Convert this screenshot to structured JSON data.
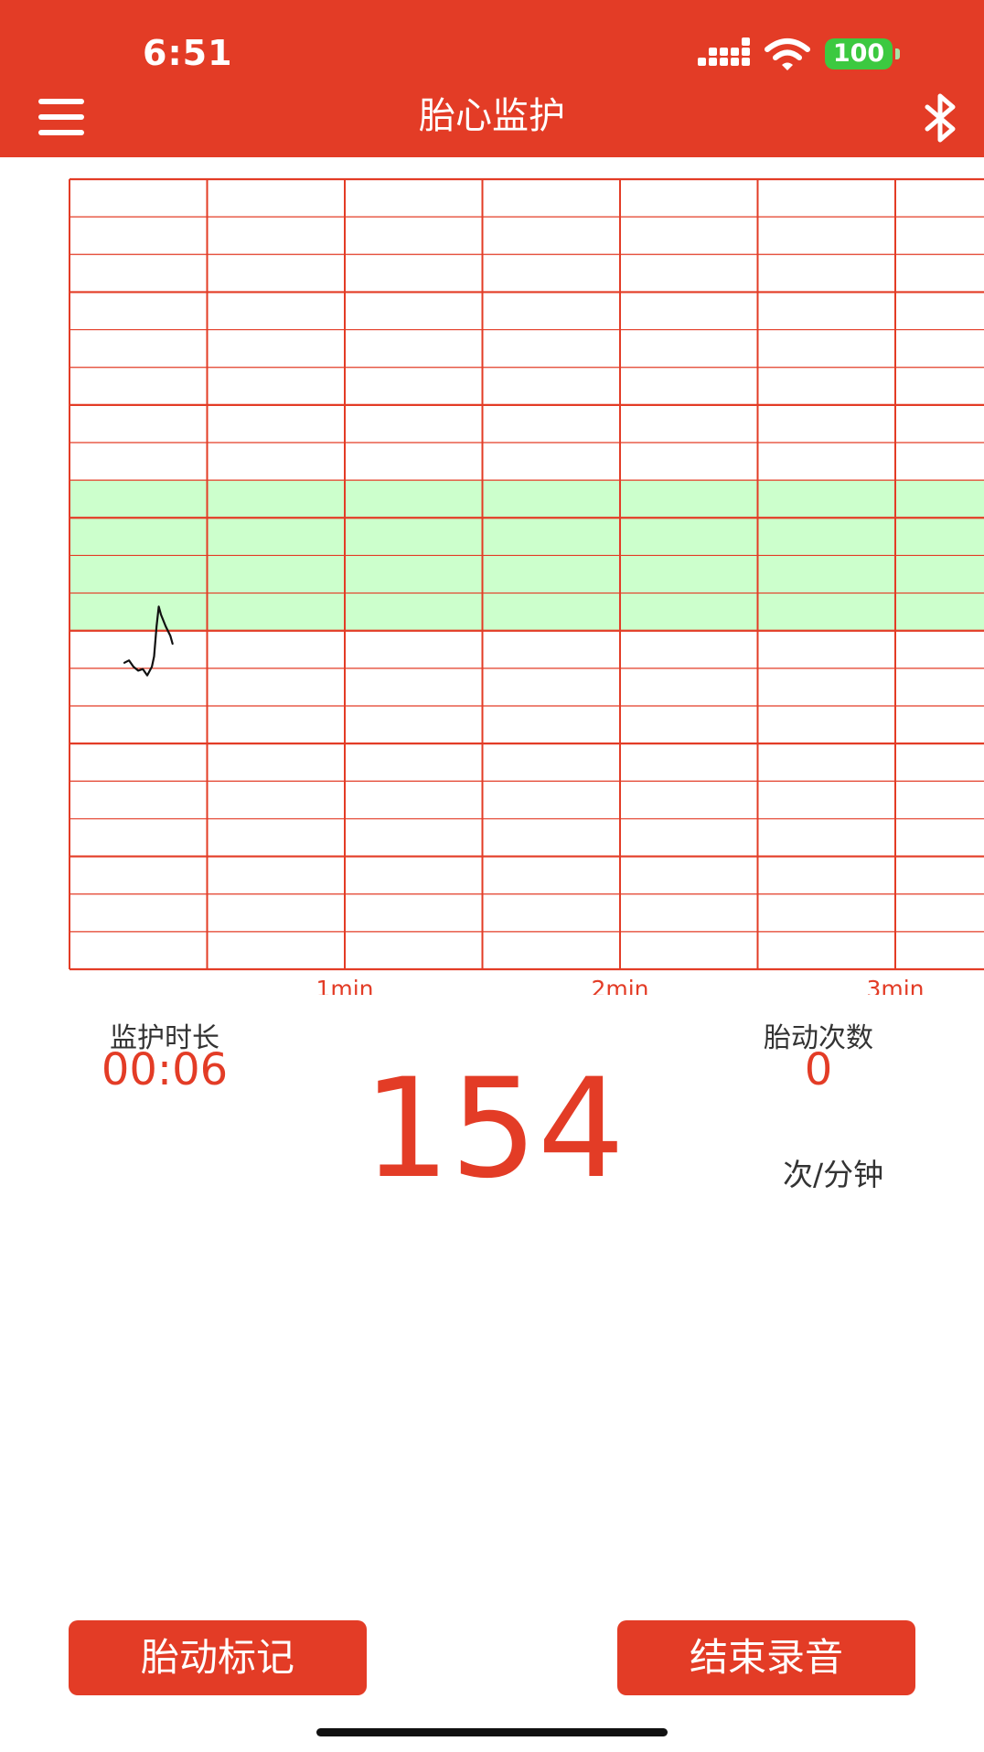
{
  "status_bar": {
    "time": "6:51",
    "battery": "100",
    "battery_color": "#3cc940"
  },
  "header": {
    "title": "胎心监护",
    "menu_icon": "hamburger-menu-icon",
    "bluetooth_icon": "bluetooth-icon",
    "color": "#e33c26"
  },
  "chart_data": {
    "type": "line",
    "grid": true,
    "x_unit": "min",
    "x_ticks": [
      "1min",
      "2min",
      "3min"
    ],
    "normal_band_color": "#ccffcc",
    "series": [
      {
        "x": [
          0.0,
          0.017,
          0.033,
          0.05,
          0.067,
          0.083,
          0.1,
          0.108,
          0.117,
          0.125,
          0.133,
          0.15,
          0.167,
          0.175
        ],
        "values": [
          0.612,
          0.609,
          0.617,
          0.622,
          0.62,
          0.628,
          0.617,
          0.604,
          0.566,
          0.541,
          0.551,
          0.566,
          0.578,
          0.588
        ]
      }
    ]
  },
  "stats": {
    "duration_label": "监护时长",
    "duration_value": "00:06",
    "fm_label": "胎动次数",
    "fm_value": "0",
    "heart_rate": "154",
    "unit": "次/分钟"
  },
  "buttons": {
    "left": "胎动标记",
    "right": "结束录音"
  }
}
